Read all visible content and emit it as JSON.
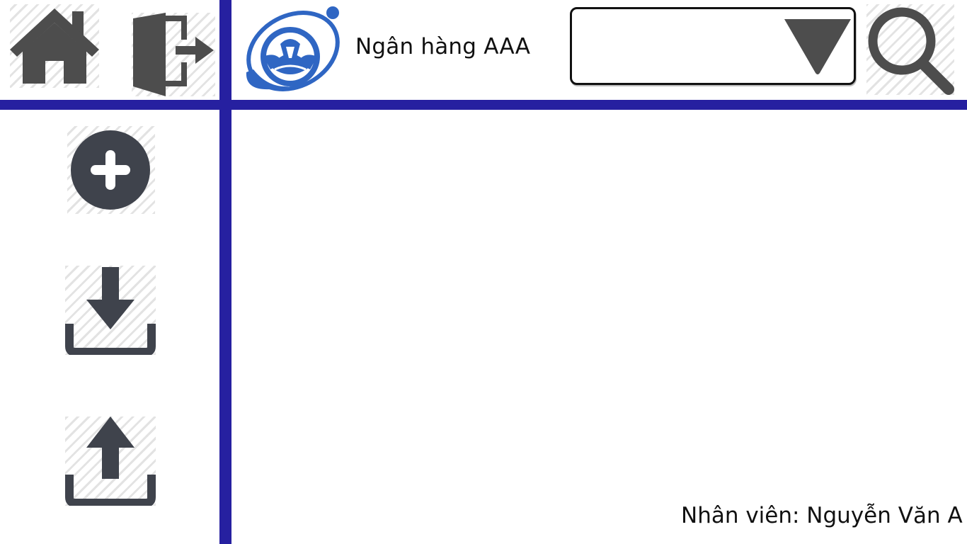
{
  "header": {
    "bank_name": "Ngân hàng AAA",
    "branch_select": {
      "value": ""
    }
  },
  "footer": {
    "employee_label": "Nhân viên: Nguyễn Văn A"
  },
  "icons": {
    "home": "home-icon",
    "logout": "logout-icon",
    "search": "search-icon",
    "dropdown": "triangle-down-icon",
    "add": "plus-circle-icon",
    "download": "download-icon",
    "upload": "upload-icon",
    "logo": "bank-logo"
  },
  "colors": {
    "divider": "#2620a0",
    "icon": "#4d4d4d",
    "icon_sidebar": "#3f434c",
    "logo_blue": "#2f66c3"
  }
}
